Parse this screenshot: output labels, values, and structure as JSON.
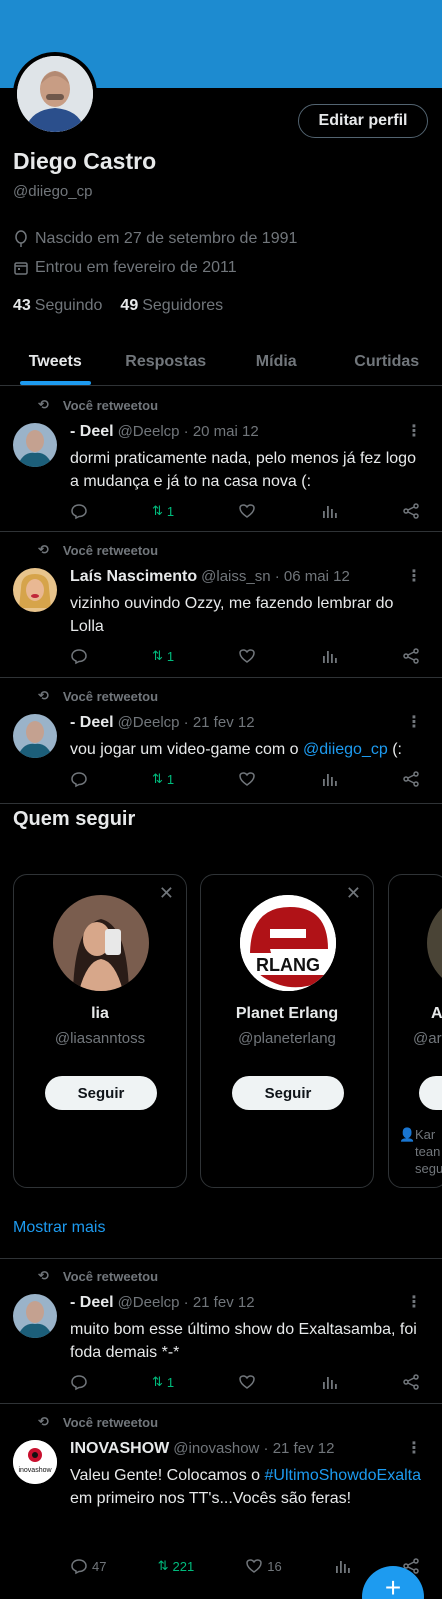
{
  "profile": {
    "name": "Diego Castro",
    "handle": "@diiego_cp",
    "edit_button": "Editar perfil",
    "birth": "Nascido em 27 de setembro de 1991",
    "joined": "Entrou em fevereiro de 2011",
    "following_count": "43",
    "following_label": "Seguindo",
    "followers_count": "49",
    "followers_label": "Seguidores"
  },
  "tabs": [
    {
      "label": "Tweets",
      "active": true
    },
    {
      "label": "Respostas",
      "active": false
    },
    {
      "label": "Mídia",
      "active": false
    },
    {
      "label": "Curtidas",
      "active": false
    }
  ],
  "retweet_label": "Você retweetou",
  "tweets": [
    {
      "author": "- Deel",
      "handle": "@Deelcp",
      "date": "· 20 mai 12",
      "text": "dormi praticamente nada, pelo menos já fez logo a mudança e já to na casa nova (:",
      "retweets": "1"
    },
    {
      "author": "Laís Nascimento",
      "handle": "@laiss_sn",
      "date": "· 06 mai 12",
      "text": "vizinho ouvindo Ozzy, me fazendo lembrar do Lolla",
      "retweets": "1"
    },
    {
      "author": "- Deel",
      "handle": "@Deelcp",
      "date": "· 21 fev 12",
      "text_before": "vou jogar um video-game com o ",
      "mention": "@diiego_cp",
      "text_after": " (:",
      "retweets": "1"
    },
    {
      "author": "- Deel",
      "handle": "@Deelcp",
      "date": "· 21 fev 12",
      "text": "muito bom esse último show do Exaltasamba, foi foda demais *-*",
      "retweets": "1"
    },
    {
      "author": "INOVASHOW",
      "handle": "@inovashow",
      "date": "· 21 fev 12",
      "text_before": "Valeu Gente! Colocamos o ",
      "hashtag": "#UltimoShowdoExalta",
      "text_after": " em primeiro nos TT's...Vocês são feras!",
      "replies": "47",
      "retweets": "221",
      "likes": "16",
      "avatar_text": "inovashow"
    }
  ],
  "who_to_follow": {
    "title": "Quem seguir",
    "cards": [
      {
        "name": "lia",
        "handle": "@liasanntoss",
        "button": "Seguir"
      },
      {
        "name": "Planet Erlang",
        "handle": "@planeterlang",
        "button": "Seguir",
        "logo_text": "RLANG"
      },
      {
        "name": "A",
        "handle": "@ar",
        "button": "",
        "note": "Kar tean segu"
      }
    ],
    "show_more": "Mostrar mais"
  },
  "colors": {
    "banner": "#1d8bd0",
    "accent": "#1d9bf0",
    "retweet_green": "#00ba7c",
    "muted": "#71767b"
  }
}
